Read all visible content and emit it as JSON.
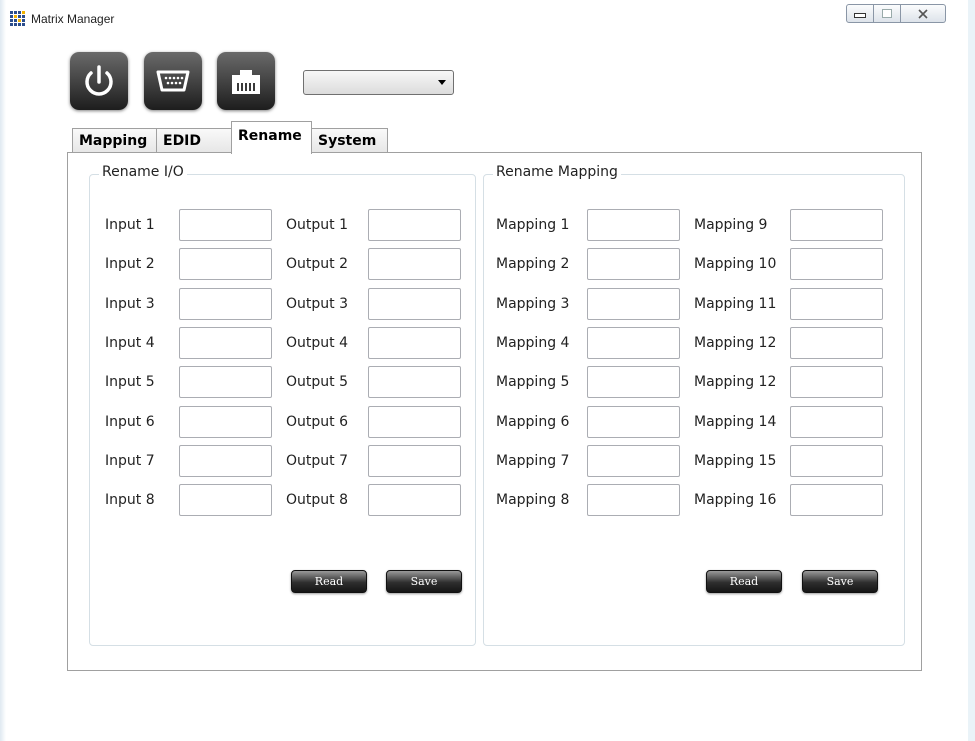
{
  "window": {
    "title": "Matrix Manager"
  },
  "toolbar": {
    "buttons": [
      "power-icon",
      "serial-port-icon",
      "ethernet-port-icon"
    ],
    "dropdown_value": ""
  },
  "tabs": [
    {
      "label": "Mapping"
    },
    {
      "label": "EDID"
    },
    {
      "label": "Rename"
    },
    {
      "label": "System"
    }
  ],
  "active_tab": "Rename",
  "rename_io": {
    "title": "Rename I/O",
    "inputs": [
      {
        "label": "Input 1",
        "value": ""
      },
      {
        "label": "Input 2",
        "value": ""
      },
      {
        "label": "Input 3",
        "value": ""
      },
      {
        "label": "Input 4",
        "value": ""
      },
      {
        "label": "Input 5",
        "value": ""
      },
      {
        "label": "Input 6",
        "value": ""
      },
      {
        "label": "Input 7",
        "value": ""
      },
      {
        "label": "Input 8",
        "value": ""
      }
    ],
    "outputs": [
      {
        "label": "Output 1",
        "value": ""
      },
      {
        "label": "Output 2",
        "value": ""
      },
      {
        "label": "Output 3",
        "value": ""
      },
      {
        "label": "Output 4",
        "value": ""
      },
      {
        "label": "Output 5",
        "value": ""
      },
      {
        "label": "Output 6",
        "value": ""
      },
      {
        "label": "Output 7",
        "value": ""
      },
      {
        "label": "Output 8",
        "value": ""
      }
    ],
    "read_label": "Read",
    "save_label": "Save"
  },
  "rename_mapping": {
    "title": "Rename Mapping",
    "left": [
      {
        "label": "Mapping 1",
        "value": ""
      },
      {
        "label": "Mapping 2",
        "value": ""
      },
      {
        "label": "Mapping 3",
        "value": ""
      },
      {
        "label": "Mapping 4",
        "value": ""
      },
      {
        "label": "Mapping 5",
        "value": ""
      },
      {
        "label": "Mapping 6",
        "value": ""
      },
      {
        "label": "Mapping 7",
        "value": ""
      },
      {
        "label": "Mapping 8",
        "value": ""
      }
    ],
    "right": [
      {
        "label": "Mapping 9",
        "value": ""
      },
      {
        "label": "Mapping 10",
        "value": ""
      },
      {
        "label": "Mapping 11",
        "value": ""
      },
      {
        "label": "Mapping 12",
        "value": ""
      },
      {
        "label": "Mapping 12",
        "value": ""
      },
      {
        "label": "Mapping 14",
        "value": ""
      },
      {
        "label": "Mapping 15",
        "value": ""
      },
      {
        "label": "Mapping 16",
        "value": ""
      }
    ],
    "read_label": "Read",
    "save_label": "Save"
  },
  "colors": {
    "window_bg": "#ffffff",
    "group_border": "#d5dfe5",
    "button_dark": "#1d1d1d"
  }
}
